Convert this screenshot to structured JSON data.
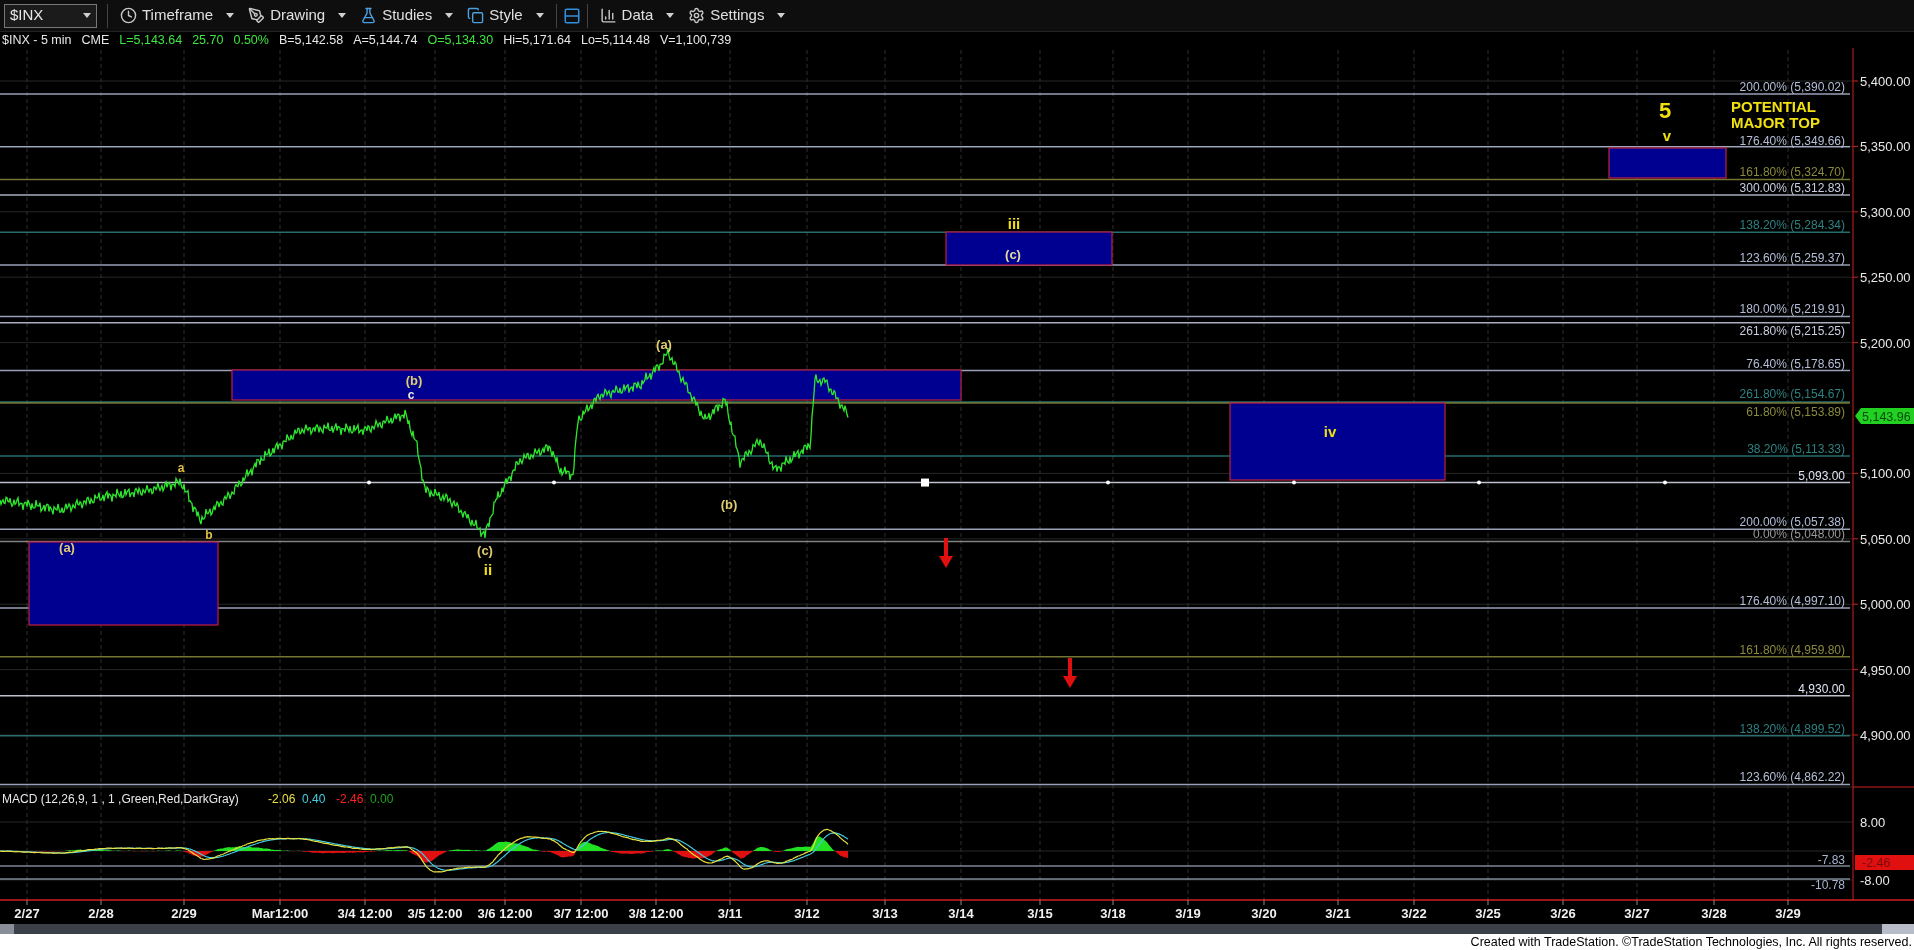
{
  "toolbar": {
    "symbol": "$INX",
    "menus": [
      {
        "label": "Timeframe",
        "kind": "clock"
      },
      {
        "label": "Drawing",
        "kind": "pen"
      },
      {
        "label": "Studies",
        "kind": "flask"
      },
      {
        "label": "Style",
        "kind": "style"
      },
      {
        "kind": "layout"
      },
      {
        "label": "Data",
        "kind": "data"
      },
      {
        "label": "Settings",
        "kind": "gear"
      }
    ]
  },
  "quote_line": [
    {
      "text": "$INX - 5 min",
      "color": "#e8e8e8"
    },
    {
      "text": "CME",
      "color": "#e8e8e8"
    },
    {
      "text": "L=5,143.64",
      "color": "#3ee63e"
    },
    {
      "text": "25.70",
      "color": "#3ee63e"
    },
    {
      "text": "0.50%",
      "color": "#3ee63e"
    },
    {
      "text": "B=5,142.58",
      "color": "#e8e8e8"
    },
    {
      "text": "A=5,144.74",
      "color": "#e8e8e8"
    },
    {
      "text": "O=5,134.30",
      "color": "#3ee63e"
    },
    {
      "text": "Hi=5,171.64",
      "color": "#e8e8e8"
    },
    {
      "text": "Lo=5,114.48",
      "color": "#e8e8e8"
    },
    {
      "text": "V=1,100,739",
      "color": "#e8e8e8"
    }
  ],
  "levels": [
    {
      "label": "200.00% (5,390.02)",
      "color": "#b4bed6"
    },
    {
      "label": "176.40% (5,349.66)",
      "color": "#b4bed6"
    },
    {
      "label": "161.80% (5,324.70)",
      "color": "#8a8a3c"
    },
    {
      "label": "300.00% (5,312.83)",
      "color": "#c8cee0"
    },
    {
      "label": "138.20% (5,284.34)",
      "color": "#2e8080"
    },
    {
      "label": "123.60% (5,259.37)",
      "color": "#b4bed6"
    },
    {
      "label": "180.00% (5,219.91)",
      "color": "#b4bed6"
    },
    {
      "label": "261.80% (5,215.25)",
      "color": "#c8cee0"
    },
    {
      "label": "76.40% (5,178.65)",
      "color": "#b4bed6"
    },
    {
      "label": "261.80% (5,154.67)",
      "color": "#2e8080"
    },
    {
      "label": "61.80% (5,153.89)",
      "color": "#8a8a3c"
    },
    {
      "label": "38.20% (5,113.33)",
      "color": "#2e8080"
    },
    {
      "label": "5,093.00",
      "color": "#e0e4f4"
    },
    {
      "label": "200.00% (5,057.38)",
      "color": "#b4bed6"
    },
    {
      "label": "0.00% (5,048.00)",
      "color": "#9a9a9a"
    },
    {
      "label": "176.40% (4,997.10)",
      "color": "#b4bed6"
    },
    {
      "label": "161.80% (4,959.80)",
      "color": "#8a8a3c"
    },
    {
      "label": "4,930.00",
      "color": "#e0e4f4"
    },
    {
      "label": "138.20% (4,899.52)",
      "color": "#2e8080"
    },
    {
      "label": "123.60% (4,862.22)",
      "color": "#b4bed6"
    }
  ],
  "wave_labels": [
    {
      "text": "(a)",
      "kind": "minor",
      "color": "#e0cc70"
    },
    {
      "text": "a",
      "kind": "small",
      "color": "#e0c040"
    },
    {
      "text": "b",
      "kind": "small",
      "color": "#e0c040"
    },
    {
      "text": "(b)",
      "kind": "minor",
      "color": "#e0cc70"
    },
    {
      "text": "c",
      "kind": "small",
      "color": "#e8e8e8"
    },
    {
      "text": "(c)",
      "kind": "minor",
      "color": "#e0cc70"
    },
    {
      "text": "ii",
      "kind": "major",
      "color": "#f0e010"
    },
    {
      "text": "(a)",
      "kind": "minor",
      "color": "#e0cc70"
    },
    {
      "text": "(b)",
      "kind": "minor",
      "color": "#e0cc70"
    },
    {
      "text": "iii",
      "kind": "major",
      "color": "#f0e010"
    },
    {
      "text": "(c)",
      "kind": "minor",
      "color": "#e8dca0"
    },
    {
      "text": "iv",
      "kind": "major",
      "color": "#f0e010"
    },
    {
      "text": "5",
      "kind": "large",
      "color": "#f0e010"
    },
    {
      "text": "v",
      "kind": "major",
      "color": "#f0e010"
    }
  ],
  "callout": [
    "POTENTIAL",
    "MAJOR TOP"
  ],
  "price_axis": [
    "5,400.00",
    "5,350.00",
    "5,300.00",
    "5,250.00",
    "5,200.00",
    "5,100.00",
    "5,050.00",
    "5,000.00",
    "4,950.00",
    "4,900.00"
  ],
  "last_price": "5,143.96",
  "macd": {
    "title": "MACD (12,26,9, 1 , 1 ,Green,Red,DarkGray)",
    "values": [
      {
        "text": "-2.06",
        "color": "#e8e040"
      },
      {
        "text": "0.40",
        "color": "#40d0e0"
      },
      {
        "text": "-2.46",
        "color": "#ff2020"
      },
      {
        "text": "0.00",
        "color": "#20a020"
      }
    ],
    "axis": [
      "8.00",
      "-8.00"
    ],
    "badge": "-2.46",
    "line_labels": [
      "-7.83",
      "-10.78"
    ]
  },
  "dates": [
    "2/27",
    "2/28",
    "2/29",
    "Mar12:00",
    "3/4 12:00",
    "3/5 12:00",
    "3/6 12:00",
    "3/7 12:00",
    "3/8 12:00",
    "3/11",
    "3/12",
    "3/13",
    "3/14",
    "3/15",
    "3/18",
    "3/19",
    "3/20",
    "3/21",
    "3/22",
    "3/25",
    "3/26",
    "3/27",
    "3/28",
    "3/29"
  ],
  "footer": "Created with TradeStation. ©TradeStation Technologies, Inc. All rights reserved."
}
